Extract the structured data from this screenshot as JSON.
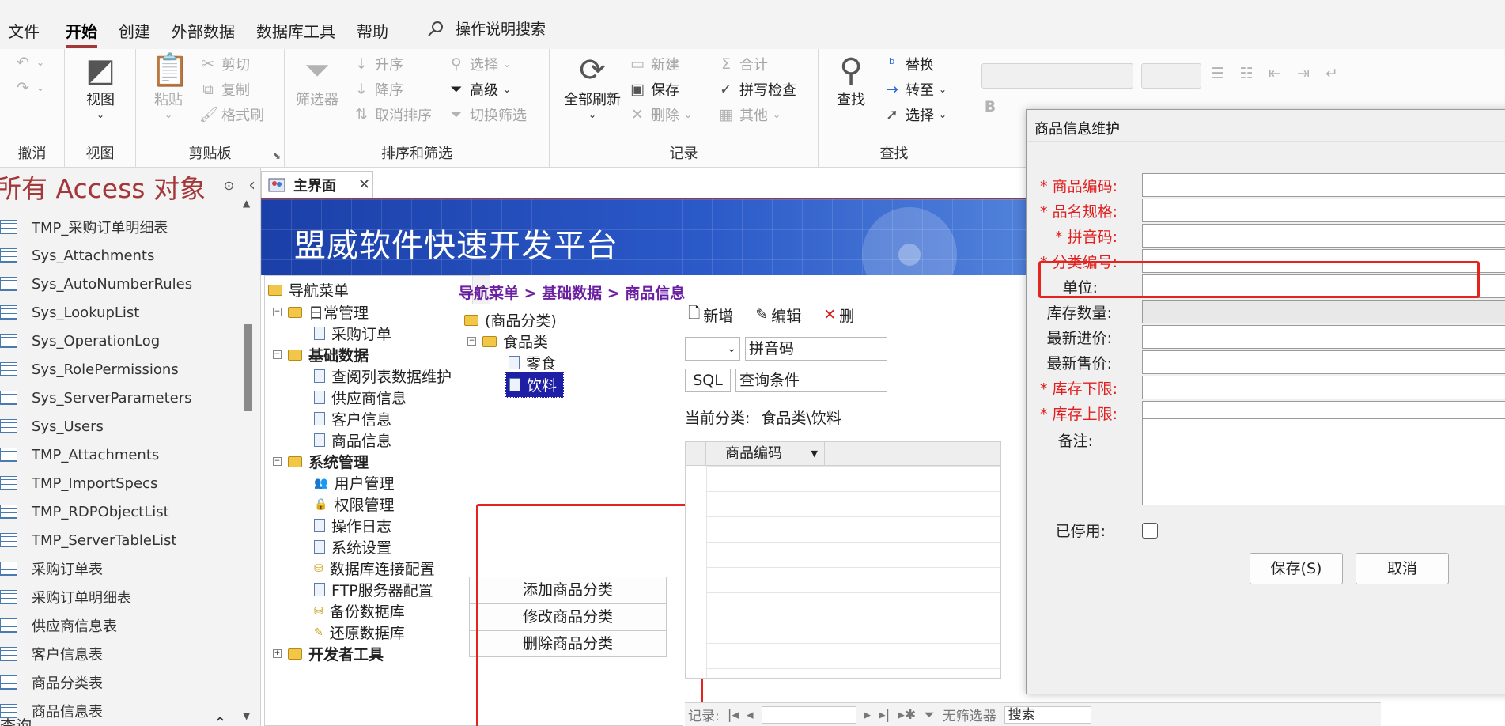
{
  "menu": {
    "items": [
      "文件",
      "开始",
      "创建",
      "外部数据",
      "数据库工具",
      "帮助"
    ],
    "search_label": "操作说明搜索"
  },
  "ribbon": {
    "groups": {
      "undo": "撤消",
      "view": "视图",
      "clipboard": "剪贴板",
      "sort_filter": "排序和筛选",
      "records": "记录",
      "find": "查找"
    },
    "view_btn": "视图",
    "paste": "粘贴",
    "cut": "剪切",
    "copy": "复制",
    "format_painter": "格式刷",
    "filter": "筛选器",
    "ascending": "升序",
    "descending": "降序",
    "remove_sort": "取消排序",
    "selection": "选择",
    "advanced": "高级",
    "toggle_filter": "切换筛选",
    "refresh_all": "全部刷新",
    "new": "新建",
    "save": "保存",
    "delete": "删除",
    "totals": "合计",
    "spelling": "拼写检查",
    "more": "其他",
    "find": "查找",
    "replace": "替换",
    "goto": "转至",
    "select": "选择"
  },
  "nav": {
    "title": "所有 Access 对象",
    "items": [
      "TMP_采购订单明细表",
      "Sys_Attachments",
      "Sys_AutoNumberRules",
      "Sys_LookupList",
      "Sys_OperationLog",
      "Sys_RolePermissions",
      "Sys_ServerParameters",
      "Sys_Users",
      "TMP_Attachments",
      "TMP_ImportSpecs",
      "TMP_RDPObjectList",
      "TMP_ServerTableList",
      "采购订单表",
      "采购订单明细表",
      "供应商信息表",
      "客户信息表",
      "商品分类表",
      "商品信息表"
    ],
    "bottom_section": "查询"
  },
  "doc": {
    "tab_label": "主界面",
    "banner_title": "盟威软件快速开发平台",
    "breadcrumb": "导航菜单 > 基础数据 > 商品信息"
  },
  "tree": {
    "root": "导航菜单",
    "daily": "日常管理",
    "purchase_order": "采购订单",
    "basic": "基础数据",
    "lookup_maint": "查阅列表数据维护",
    "supplier": "供应商信息",
    "customer": "客户信息",
    "goods": "商品信息",
    "system": "系统管理",
    "users": "用户管理",
    "permissions": "权限管理",
    "oplog": "操作日志",
    "settings": "系统设置",
    "dbconn": "数据库连接配置",
    "ftp": "FTP服务器配置",
    "backup": "备份数据库",
    "restore": "还原数据库",
    "devtools": "开发者工具"
  },
  "category": {
    "root": "(商品分类)",
    "food": "食品类",
    "snack": "零食",
    "drink": "饮料",
    "add": "添加商品分类",
    "edit": "修改商品分类",
    "delete": "删除商品分类"
  },
  "goods": {
    "new": "新增",
    "edit": "编辑",
    "delete": "删",
    "field_combo": "拼音码",
    "sql_btn": "SQL",
    "query_cond": "查询条件",
    "current_cat_label": "当前分类:",
    "current_cat_value": "食品类\\饮料",
    "col_code": "商品编码",
    "record_label": "记录:",
    "no_filter": "无筛选器",
    "search": "搜索"
  },
  "dialog": {
    "title": "商品信息维护",
    "fields": {
      "code": "商品编码:",
      "name_spec": "品名规格:",
      "pinyin": "拼音码:",
      "category": "分类编号:",
      "unit": "单位:",
      "stock_qty": "库存数量:",
      "last_buy": "最新进价:",
      "last_sell": "最新售价:",
      "stock_min": "库存下限:",
      "stock_max": "库存上限:",
      "remark": "备注:",
      "disabled": "已停用:"
    },
    "save_btn": "保存(S)",
    "cancel_btn": "取消"
  },
  "colors": {
    "accent": "#a4373a",
    "required": "#e02020",
    "highlight_box": "#e5231f",
    "selected_node": "#1f1fa5",
    "breadcrumb": "#6a1fa0"
  }
}
